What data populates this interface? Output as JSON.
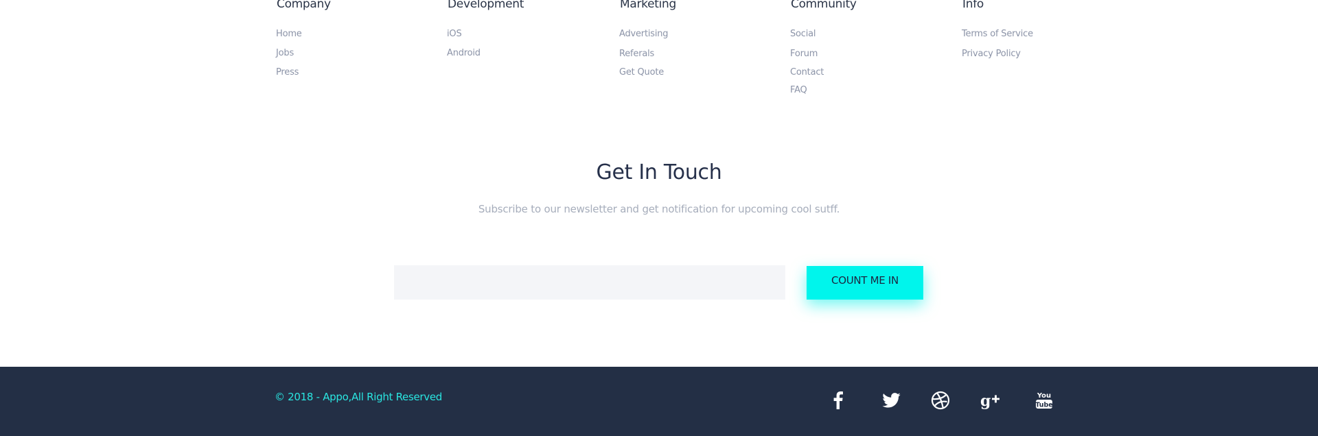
{
  "nav_columns": [
    {
      "title": "Company",
      "links": [
        "Home",
        "Jobs",
        "Press"
      ]
    },
    {
      "title": "Development",
      "links": [
        "iOS",
        "Android"
      ]
    },
    {
      "title": "Marketing",
      "links": [
        "Advertising",
        "Referals",
        "Get Quote"
      ]
    },
    {
      "title": "Community",
      "links": [
        "Social",
        "Forum",
        "Contact",
        "FAQ"
      ]
    },
    {
      "title": "Info",
      "links": [
        "Terms of Service",
        "Privacy Policy"
      ]
    }
  ],
  "newsletter": {
    "title": "Get In Touch",
    "subtitle": "Subscribe to our newsletter and get notification for upcoming cool sutff.",
    "email_placeholder": "",
    "button_label": "COUNT ME IN"
  },
  "footer": {
    "copyright": "© 2018 - Appo,All Right Reserved",
    "social_icons": [
      "facebook-icon",
      "twitter-icon",
      "dribbble-icon",
      "google-plus-icon",
      "youtube-icon"
    ]
  },
  "colors": {
    "accent": "#00f5ec",
    "copyright_text": "#2ae6e1",
    "footer_background": "#232f45",
    "heading_text": "#26304a",
    "link_text": "#8b93a7"
  }
}
